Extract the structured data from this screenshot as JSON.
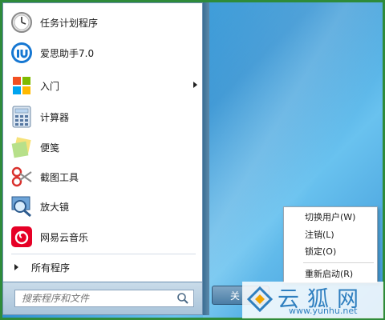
{
  "start_menu": {
    "programs": [
      {
        "label": "任务计划程序",
        "icon": "clock-icon"
      },
      {
        "label": "爱思助手7.0",
        "icon": "i4-assistant-icon"
      },
      {
        "label": "入门",
        "icon": "getting-started-icon",
        "has_submenu": true
      },
      {
        "label": "计算器",
        "icon": "calculator-icon"
      },
      {
        "label": "便笺",
        "icon": "sticky-notes-icon"
      },
      {
        "label": "截图工具",
        "icon": "scissors-icon"
      },
      {
        "label": "放大镜",
        "icon": "magnifier-icon"
      },
      {
        "label": "网易云音乐",
        "icon": "netease-music-icon"
      }
    ],
    "all_programs": "所有程序",
    "search_placeholder": "搜索程序和文件"
  },
  "shutdown": {
    "label": "关",
    "power_menu": [
      "切换用户(W)",
      "注销(L)",
      "锁定(O)",
      "重新启动(R)"
    ]
  },
  "watermark": {
    "chinese": "云狐网",
    "url": "www.yunhu.net"
  },
  "colors": {
    "frame_green": "#2e8b3a",
    "desktop_blue": "#2d8fd1",
    "watermark_blue": "#2f7fbf"
  }
}
